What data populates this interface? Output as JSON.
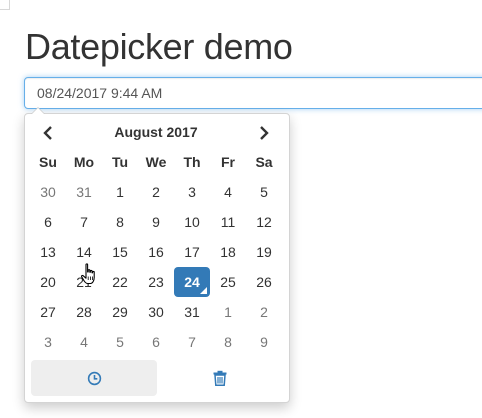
{
  "page": {
    "title": "Datepicker demo"
  },
  "input": {
    "value": "08/24/2017 9:44 AM"
  },
  "calendar": {
    "month_label": "August 2017",
    "prev_icon": "chevron-left-icon",
    "next_icon": "chevron-right-icon",
    "weekdays": [
      "Su",
      "Mo",
      "Tu",
      "We",
      "Th",
      "Fr",
      "Sa"
    ],
    "weeks": [
      [
        {
          "d": "30",
          "muted": true
        },
        {
          "d": "31",
          "muted": true
        },
        {
          "d": "1"
        },
        {
          "d": "2"
        },
        {
          "d": "3"
        },
        {
          "d": "4"
        },
        {
          "d": "5"
        }
      ],
      [
        {
          "d": "6"
        },
        {
          "d": "7"
        },
        {
          "d": "8"
        },
        {
          "d": "9"
        },
        {
          "d": "10"
        },
        {
          "d": "11"
        },
        {
          "d": "12"
        }
      ],
      [
        {
          "d": "13"
        },
        {
          "d": "14"
        },
        {
          "d": "15"
        },
        {
          "d": "16"
        },
        {
          "d": "17"
        },
        {
          "d": "18"
        },
        {
          "d": "19"
        }
      ],
      [
        {
          "d": "20"
        },
        {
          "d": "21"
        },
        {
          "d": "22"
        },
        {
          "d": "23"
        },
        {
          "d": "24",
          "active": true,
          "today": true
        },
        {
          "d": "25"
        },
        {
          "d": "26"
        }
      ],
      [
        {
          "d": "27"
        },
        {
          "d": "28"
        },
        {
          "d": "29"
        },
        {
          "d": "30"
        },
        {
          "d": "31"
        },
        {
          "d": "1",
          "muted": true
        },
        {
          "d": "2",
          "muted": true
        }
      ],
      [
        {
          "d": "3",
          "muted": true
        },
        {
          "d": "4",
          "muted": true
        },
        {
          "d": "5",
          "muted": true
        },
        {
          "d": "6",
          "muted": true
        },
        {
          "d": "7",
          "muted": true
        },
        {
          "d": "8",
          "muted": true
        },
        {
          "d": "9",
          "muted": true
        }
      ]
    ]
  },
  "toolbar": {
    "time_icon": "clock-icon",
    "clear_icon": "trash-icon"
  },
  "colors": {
    "accent": "#337ab7",
    "input_focus_border": "#66afe9",
    "muted_text": "#777777",
    "hover_bg": "#eeeeee"
  }
}
